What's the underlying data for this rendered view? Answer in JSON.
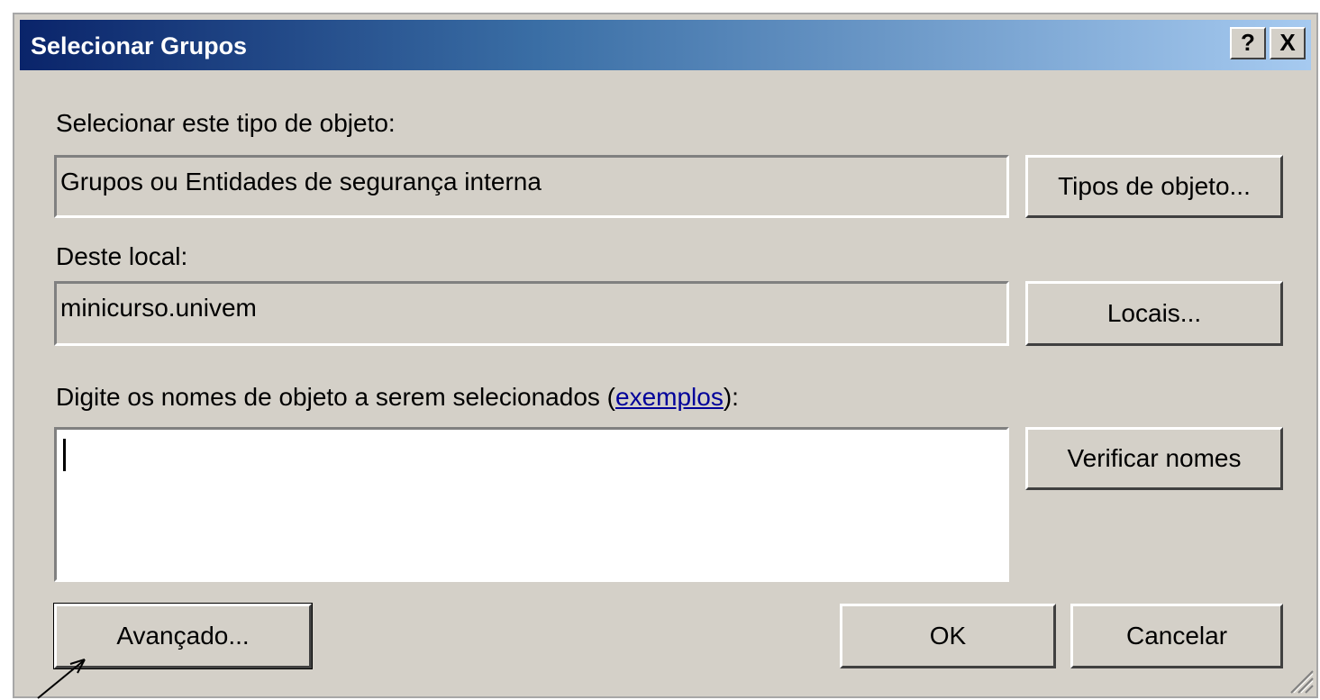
{
  "window": {
    "title": "Selecionar Grupos",
    "help_label": "?",
    "close_label": "X"
  },
  "object_type": {
    "label": "Selecionar este tipo de objeto:",
    "value": "Grupos ou Entidades de segurança interna",
    "button_label": "Tipos de objeto..."
  },
  "location": {
    "label": "Deste local:",
    "value": "minicurso.univem",
    "button_label": "Locais..."
  },
  "names": {
    "label_prefix": "Digite os nomes de objeto a serem selecionados (",
    "link_text": "exemplos",
    "label_suffix": "):",
    "value": "",
    "check_button_label": "Verificar nomes"
  },
  "footer": {
    "advanced_label": "Avançado...",
    "ok_label": "OK",
    "cancel_label": "Cancelar"
  },
  "icons": {
    "help": "help-icon",
    "close": "close-icon",
    "resize": "resize-grip-icon",
    "pointer": "pointer-arrow-icon"
  },
  "colors": {
    "titlebar_start": "#0a246a",
    "titlebar_end": "#a6caf0",
    "dialog_bg": "#d4d0c8",
    "link": "#00009a"
  }
}
